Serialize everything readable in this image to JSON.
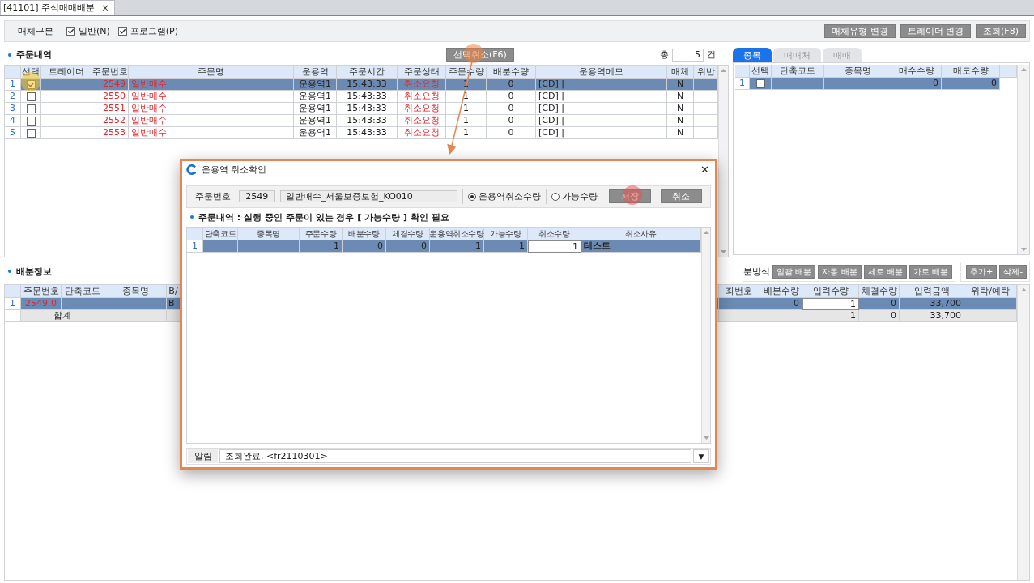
{
  "tab": {
    "label": "[41101] 주식매매배분",
    "close": "×"
  },
  "filter": {
    "label": "매체구분",
    "options": [
      {
        "label": "일반(N)",
        "checked": true
      },
      {
        "label": "프로그램(P)",
        "checked": true
      }
    ],
    "buttons": [
      "매체유형 변경",
      "트레이더 변경",
      "조회(F8)"
    ]
  },
  "orders": {
    "title": "주문내역",
    "cancel_button": "선택취소(F6)",
    "total_label": "총",
    "total": "5",
    "total_unit": "건",
    "columns": [
      "선택",
      "트레이더",
      "주문번호",
      "주문명",
      "운용역",
      "주문시간",
      "주문상태",
      "주문수량",
      "배분수량",
      "운용역메모",
      "매체",
      "위반"
    ],
    "rows": [
      {
        "no": "1",
        "selected": true,
        "checked": true,
        "order_no": "2549",
        "name": "일반매수",
        "manager": "운용역1",
        "time": "15:43:33",
        "status": "취소요청",
        "qty": "1",
        "alloc": "0",
        "memo": "[CD] |",
        "media": "N"
      },
      {
        "no": "2",
        "selected": false,
        "checked": false,
        "order_no": "2550",
        "name": "일반매수",
        "manager": "운용역1",
        "time": "15:43:33",
        "status": "취소요청",
        "qty": "1",
        "alloc": "0",
        "memo": "[CD] |",
        "media": "N"
      },
      {
        "no": "3",
        "selected": false,
        "checked": false,
        "order_no": "2551",
        "name": "일반매수",
        "manager": "운용역1",
        "time": "15:43:33",
        "status": "취소요청",
        "qty": "1",
        "alloc": "0",
        "memo": "[CD] |",
        "media": "N"
      },
      {
        "no": "4",
        "selected": false,
        "checked": false,
        "order_no": "2552",
        "name": "일반매수",
        "manager": "운용역1",
        "time": "15:43:33",
        "status": "취소요청",
        "qty": "1",
        "alloc": "0",
        "memo": "[CD] |",
        "media": "N"
      },
      {
        "no": "5",
        "selected": false,
        "checked": false,
        "order_no": "2553",
        "name": "일반매수",
        "manager": "운용역1",
        "time": "15:43:33",
        "status": "취소요청",
        "qty": "1",
        "alloc": "0",
        "memo": "[CD] |",
        "media": "N"
      }
    ]
  },
  "items": {
    "tabs": [
      {
        "label": "종목",
        "selected": true
      },
      {
        "label": "매매처",
        "selected": false
      },
      {
        "label": "매매",
        "selected": false
      }
    ],
    "columns": [
      "선택",
      "단축코드",
      "종목명",
      "매수수량",
      "매도수량"
    ],
    "rows": [
      {
        "no": "1",
        "selected": true,
        "checked": false,
        "buy": "0",
        "sell": "0"
      }
    ]
  },
  "allocation": {
    "title": "배분정보",
    "method_label": "분방식",
    "buttons": [
      "일괄 배분",
      "자동 배분",
      "세로 배분",
      "가로 배분"
    ],
    "edit_buttons": [
      "추가+",
      "삭제-"
    ],
    "columns_left": [
      "주문번호",
      "단축코드",
      "종목명",
      "B/"
    ],
    "columns_right": [
      "좌번호",
      "배분수량",
      "입력수량",
      "체결수량",
      "입력금액",
      "위탁/예탁"
    ],
    "rows": [
      {
        "no": "1",
        "selected": true,
        "order_no": "2549-0",
        "side": "B",
        "alloc": "0",
        "input": "1",
        "filled": "0",
        "amount": "33,700"
      }
    ],
    "total": {
      "label": "합계",
      "input": "1",
      "filled": "0",
      "amount": "33,700"
    }
  },
  "dialog": {
    "title": "운용역 취소확인",
    "close": "✕",
    "order_label": "주문번호",
    "order_no": "2549",
    "order_name": "일반매수_서울보증보험_KO010",
    "modes": [
      {
        "label": "운용역취소수량",
        "selected": true
      },
      {
        "label": "가능수량",
        "selected": false
      }
    ],
    "buttons": [
      "저장",
      "취소"
    ],
    "section_title": "주문내역 : 실행 중인 주문이 있는 경우 [ 가능수량 ] 확인 필요",
    "columns": [
      "단축코드",
      "종목명",
      "주문수량",
      "배분수량",
      "체결수량",
      "운용역취소수량",
      "가능수량",
      "취소수량",
      "취소사유"
    ],
    "rows": [
      {
        "no": "1",
        "selected": true,
        "order_qty": "1",
        "alloc": "0",
        "filled": "0",
        "mgr_cancel": "1",
        "avail": "1",
        "cancel_qty": "1",
        "reason": "테스트"
      }
    ],
    "status_label": "알림",
    "status": "조회완료. <fr2110301>",
    "status_menu": "▼"
  }
}
